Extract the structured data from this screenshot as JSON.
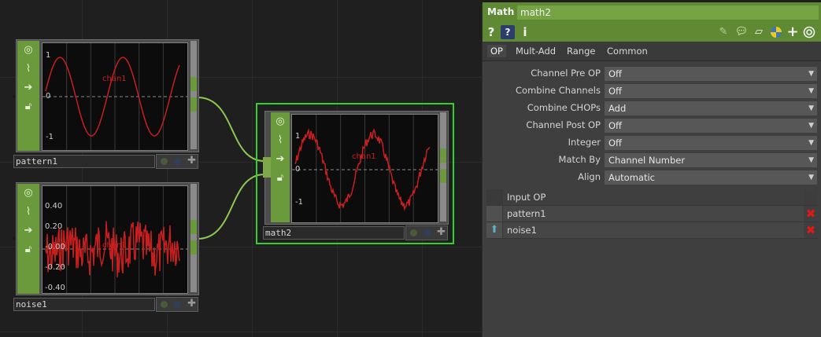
{
  "nodes": {
    "pattern1": {
      "name": "pattern1",
      "y_labels": [
        "1",
        "0",
        "-1"
      ],
      "channel": "chan1"
    },
    "noise1": {
      "name": "noise1",
      "y_labels": [
        "0.40",
        "0.20",
        "-0.00",
        "-0.20",
        "-0.40"
      ],
      "channel": "chan1"
    },
    "math2": {
      "name": "math2",
      "y_labels": [
        "1",
        "0",
        "-1"
      ],
      "channel": "chan1"
    }
  },
  "panel": {
    "op_type": "Math",
    "op_name": "math2",
    "toolbar": {
      "help": "?",
      "info": "i",
      "add": "+"
    },
    "tabs": [
      "OP",
      "Mult-Add",
      "Range",
      "Common"
    ],
    "params": [
      {
        "label": "Channel Pre OP",
        "value": "Off"
      },
      {
        "label": "Combine Channels",
        "value": "Off"
      },
      {
        "label": "Combine CHOPs",
        "value": "Add"
      },
      {
        "label": "Channel Post OP",
        "value": "Off"
      },
      {
        "label": "Integer",
        "value": "Off"
      },
      {
        "label": "Match By",
        "value": "Channel Number"
      },
      {
        "label": "Align",
        "value": "Automatic"
      }
    ],
    "input_table": {
      "header": "Input OP",
      "rows": [
        "pattern1",
        "noise1"
      ]
    }
  },
  "colors": {
    "accent_green": "#6b9a3c",
    "selected_border": "#34d12a",
    "wave": "#c81e1e"
  }
}
